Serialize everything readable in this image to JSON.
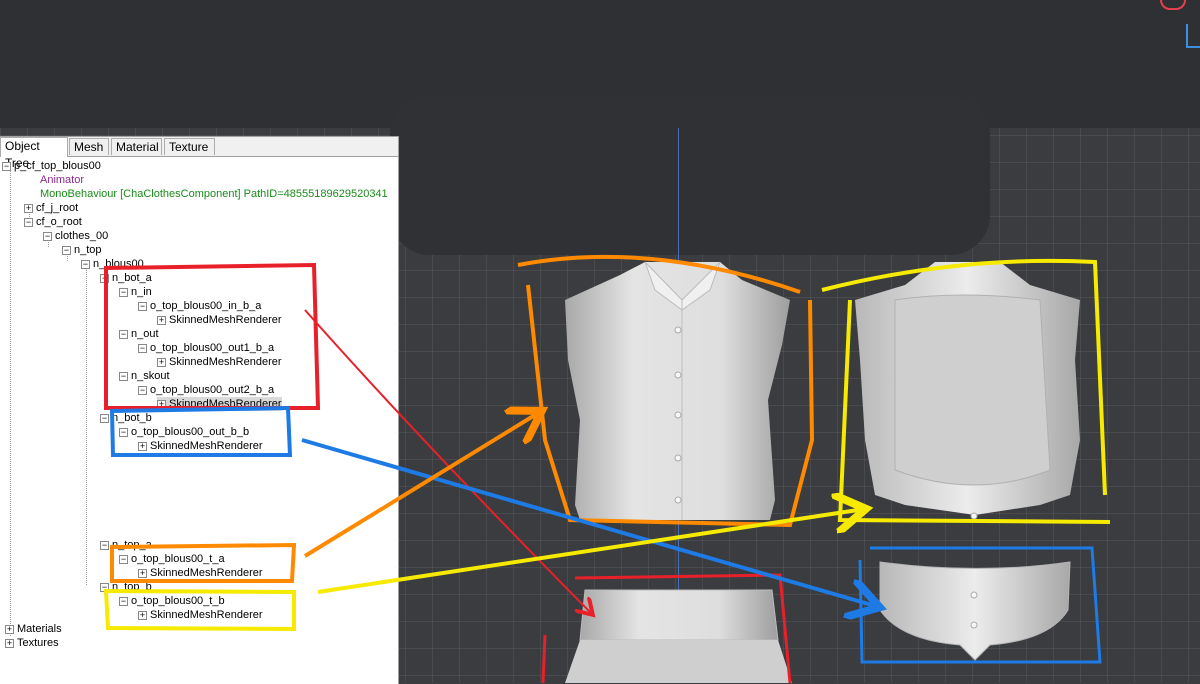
{
  "tabs": [
    "Object Tree",
    "Mesh",
    "Material",
    "Texture"
  ],
  "tree": {
    "root": "p_cf_top_blous00",
    "animator": "Animator",
    "monobehaviour": "MonoBehaviour [ChaClothesComponent] PathID=48555189629520341",
    "cf_j_root": "cf_j_root",
    "cf_o_root": "cf_o_root",
    "clothes_00": "clothes_00",
    "n_top": "n_top",
    "n_blous00": "n_blous00",
    "n_bot_a": "n_bot_a",
    "n_in": "n_in",
    "o_in": "o_top_blous00_in_b_a",
    "smr": "SkinnedMeshRenderer",
    "n_out": "n_out",
    "o_out1": "o_top_blous00_out1_b_a",
    "n_skout": "n_skout",
    "o_out2": "o_top_blous00_out2_b_a",
    "n_bot_b": "n_bot_b",
    "o_out_b": "o_top_blous00_out_b_b",
    "n_top_a": "n_top_a",
    "o_t_a": "o_top_blous00_t_a",
    "n_top_b": "n_top_b",
    "o_t_b": "o_top_blous00_t_b",
    "materials": "Materials",
    "textures": "Textures"
  },
  "colors": {
    "red": "#e8202a",
    "orange": "#ff8a00",
    "yellow": "#f5ea00",
    "blue": "#1e7be6",
    "mesh": "#d8d8d8"
  }
}
